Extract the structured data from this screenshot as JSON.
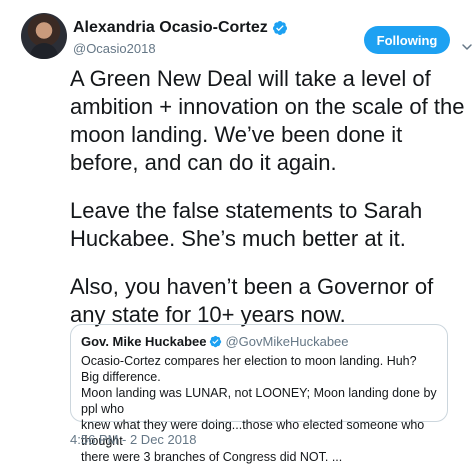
{
  "author": {
    "name": "Alexandria Ocasio-Cortez",
    "handle": "@Ocasio2018"
  },
  "follow_button": {
    "label": "Following"
  },
  "tweet": {
    "paragraphs": [
      "A Green New Deal will take a level of\nambition + innovation on the scale of the\nmoon landing. We’ve been done it\nbefore, and can do it again.",
      "Leave the false statements to Sarah\nHuckabee. She’s much better at it.",
      "Also, you haven’t been a Governor of\nany state for 10+ years now."
    ],
    "timestamp": "4:56 PM - 2 Dec 2018"
  },
  "quoted_tweet": {
    "name": "Gov. Mike Huckabee",
    "handle": "@GovMikeHuckabee",
    "text": "Ocasio-Cortez compares her election to moon landing. Huh? Big difference.\nMoon landing was LUNAR, not LOONEY; Moon landing done by ppl who\nknew what they were doing...those who elected someone who thought\nthere were 3 branches of Congress did NOT.  ..."
  },
  "icons": [
    "verified-badge-icon",
    "chevron-down-icon"
  ],
  "colors": {
    "accent": "#1da1f2",
    "secondary_text": "#657786",
    "border": "#ccd6dd"
  }
}
